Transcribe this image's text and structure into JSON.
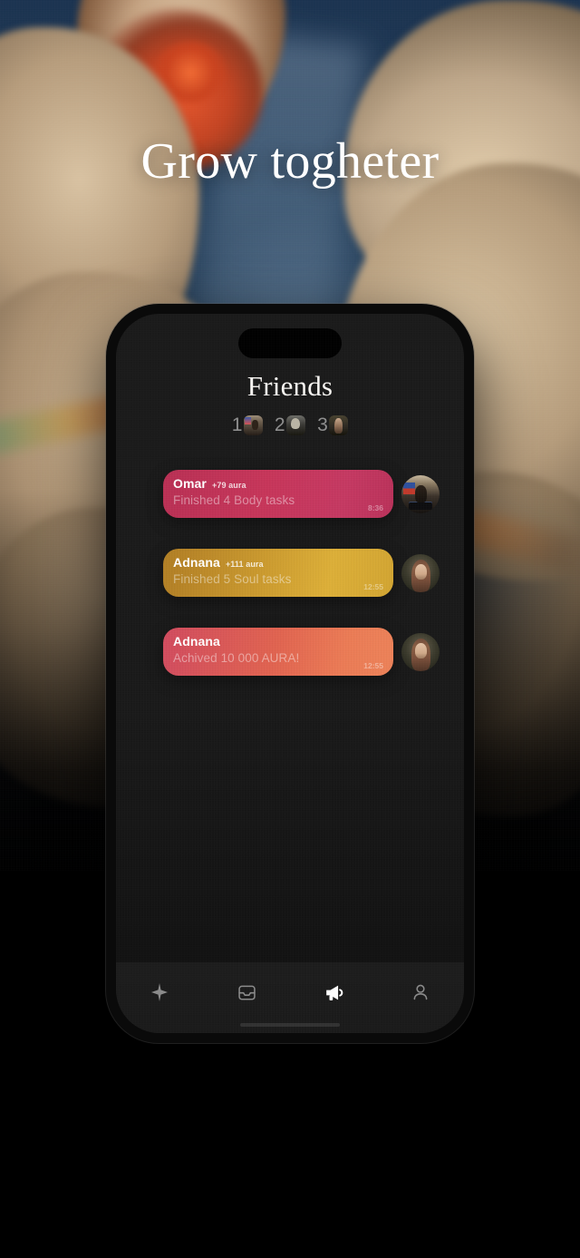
{
  "headline": "Grow togheter",
  "phone": {
    "screen_title": "Friends",
    "leaderboard": {
      "entries": [
        {
          "rank": "1",
          "avatar_icon": "leader-avatar-1-thumb"
        },
        {
          "rank": "2",
          "avatar_icon": "leader-avatar-2-thumb"
        },
        {
          "rank": "3",
          "avatar_icon": "leader-avatar-3-thumb"
        }
      ]
    },
    "feed": [
      {
        "name": "Omar",
        "aura": "+79 aura",
        "message": "Finished 4 Body tasks",
        "time": "8:36",
        "color": "#c73459",
        "avatar_icon": "omar-avatar"
      },
      {
        "name": "Adnana",
        "aura": "+111 aura",
        "message": "Finished 5 Soul tasks",
        "time": "12:55",
        "color": "#d2a430",
        "avatar_icon": "adnana-avatar"
      },
      {
        "name": "Adnana",
        "aura": "",
        "message": "Achived 10 000 AURA!",
        "time": "12:55",
        "color": "#e86f54",
        "avatar_icon": "adnana-avatar"
      }
    ],
    "nav": [
      {
        "icon": "sparkle-icon",
        "active": false
      },
      {
        "icon": "inbox-icon",
        "active": false
      },
      {
        "icon": "megaphone-icon",
        "active": true
      },
      {
        "icon": "person-icon",
        "active": false
      }
    ]
  }
}
